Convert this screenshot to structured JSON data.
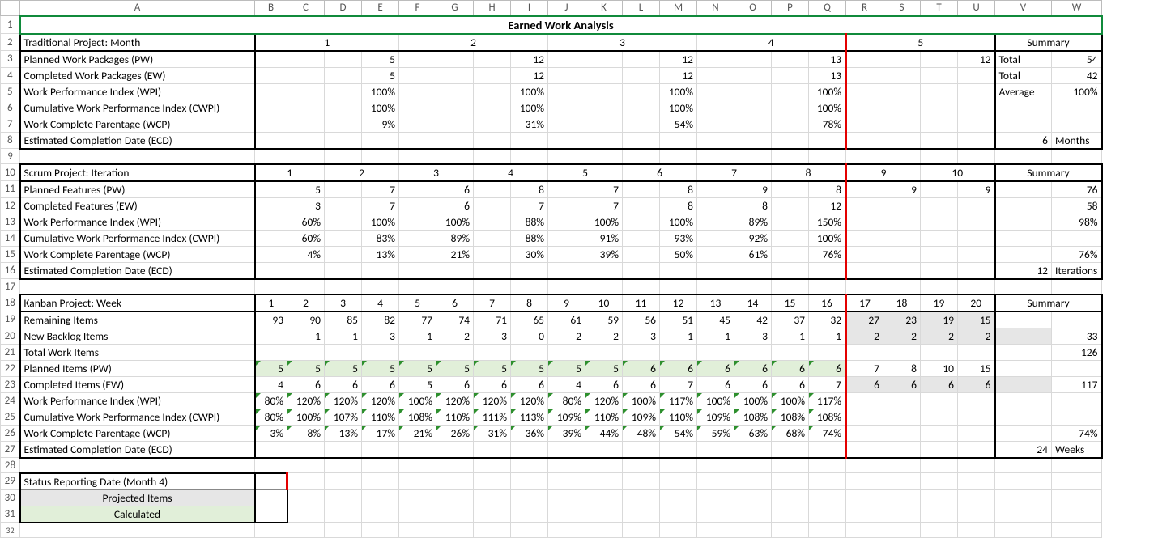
{
  "chart_data": {
    "type": "table",
    "title": "Earned Work Analysis",
    "sections": [
      {
        "name": "Traditional Project: Month",
        "periods": [
          1,
          2,
          3,
          4,
          5
        ],
        "rows": {
          "Planned Work Packages (PW)": [
            5,
            12,
            12,
            13,
            12
          ],
          "Completed Work Packages (EW)": [
            5,
            12,
            12,
            13,
            null
          ],
          "Work Performance Index (WPI)": [
            "100%",
            "100%",
            "100%",
            "100%",
            null
          ],
          "Cumulative Work Performance Index (CWPI)": [
            "100%",
            "100%",
            "100%",
            "100%",
            null
          ],
          "Work Complete Parentage (WCP)": [
            "9%",
            "31%",
            "54%",
            "78%",
            null
          ]
        },
        "summary": {
          "pw_total": 54,
          "ew_total": 42,
          "wpi_avg": "100%",
          "ecd": "6 Months"
        }
      },
      {
        "name": "Scrum Project: Iteration",
        "periods": [
          1,
          2,
          3,
          4,
          5,
          6,
          7,
          8,
          9,
          10
        ],
        "rows": {
          "Planned Features (PW)": [
            5,
            7,
            6,
            8,
            7,
            8,
            9,
            8,
            9,
            9
          ],
          "Completed Features (EW)": [
            3,
            7,
            6,
            7,
            7,
            8,
            8,
            12,
            null,
            null
          ],
          "Work Performance Index (WPI)": [
            "60%",
            "100%",
            "100%",
            "88%",
            "100%",
            "100%",
            "89%",
            "150%",
            null,
            null
          ],
          "Cumulative Work Performance Index (CWPI)": [
            "60%",
            "83%",
            "89%",
            "88%",
            "91%",
            "93%",
            "92%",
            "100%",
            null,
            null
          ],
          "Work Complete Parentage (WCP)": [
            "4%",
            "13%",
            "21%",
            "30%",
            "39%",
            "50%",
            "61%",
            "76%",
            null,
            null
          ]
        },
        "summary": {
          "pw_total": 76,
          "ew_total": 58,
          "wpi_avg": "98%",
          "wcp": "76%",
          "ecd": "12 Iterations"
        }
      },
      {
        "name": "Kanban Project: Week",
        "periods": [
          1,
          2,
          3,
          4,
          5,
          6,
          7,
          8,
          9,
          10,
          11,
          12,
          13,
          14,
          15,
          16,
          17,
          18,
          19,
          20
        ],
        "rows": {
          "Remaining Items": [
            93,
            90,
            85,
            82,
            77,
            74,
            71,
            65,
            61,
            59,
            56,
            51,
            45,
            42,
            37,
            32,
            27,
            23,
            19,
            15
          ],
          "New Backlog Items": [
            null,
            1,
            1,
            3,
            1,
            2,
            3,
            0,
            2,
            2,
            3,
            1,
            1,
            3,
            1,
            1,
            2,
            2,
            2,
            2
          ],
          "Planned Items (PW)": [
            5,
            5,
            5,
            5,
            5,
            5,
            5,
            5,
            5,
            5,
            6,
            6,
            6,
            6,
            6,
            6,
            7,
            8,
            10,
            15
          ],
          "Completed Items (EW)": [
            4,
            6,
            6,
            6,
            5,
            6,
            6,
            6,
            4,
            6,
            6,
            7,
            6,
            6,
            6,
            7,
            6,
            6,
            6,
            6
          ],
          "Work Performance Index (WPI)": [
            "80%",
            "120%",
            "120%",
            "120%",
            "100%",
            "120%",
            "120%",
            "120%",
            "80%",
            "120%",
            "100%",
            "117%",
            "100%",
            "100%",
            "100%",
            "117%",
            null,
            null,
            null,
            null
          ],
          "Cumulative Work Performance Index (CWPI)": [
            "80%",
            "100%",
            "107%",
            "110%",
            "108%",
            "110%",
            "111%",
            "113%",
            "109%",
            "110%",
            "109%",
            "110%",
            "109%",
            "108%",
            "108%",
            "108%",
            null,
            null,
            null,
            null
          ],
          "Work Complete Parentage (WCP)": [
            "3%",
            "8%",
            "13%",
            "17%",
            "21%",
            "26%",
            "31%",
            "36%",
            "39%",
            "44%",
            "48%",
            "54%",
            "59%",
            "63%",
            "68%",
            "74%",
            null,
            null,
            null,
            null
          ]
        },
        "summary": {
          "new_backlog_total": 33,
          "total_work_items": 126,
          "ew_total": 117,
          "wcp": "74%",
          "ecd": "24 Weeks"
        }
      }
    ],
    "status_date": "Status Reporting Date (Month 4)",
    "legend": [
      "Projected Items",
      "Calculated"
    ]
  },
  "col_headers": [
    "",
    "A",
    "B",
    "C",
    "D",
    "E",
    "F",
    "G",
    "H",
    "I",
    "J",
    "K",
    "L",
    "M",
    "N",
    "O",
    "P",
    "Q",
    "R",
    "S",
    "T",
    "U",
    "V",
    "W"
  ],
  "title": "Earned Work Analysis",
  "r2": {
    "a": "Traditional Project: Month",
    "periods": [
      "1",
      "2",
      "3",
      "4",
      "5"
    ],
    "sum": "Summary"
  },
  "r3": {
    "a": "Planned Work Packages (PW)",
    "v": [
      "5",
      "12",
      "12",
      "13",
      "12"
    ],
    "slabel": "Total",
    "sval": "54"
  },
  "r4": {
    "a": "Completed Work Packages (EW)",
    "v": [
      "5",
      "12",
      "12",
      "13"
    ],
    "slabel": "Total",
    "sval": "42"
  },
  "r5": {
    "a": "Work Performance Index (WPI)",
    "v": [
      "100%",
      "100%",
      "100%",
      "100%"
    ],
    "slabel": "Average",
    "sval": "100%"
  },
  "r6": {
    "a": "Cumulative Work Performance Index (CWPI)",
    "v": [
      "100%",
      "100%",
      "100%",
      "100%"
    ]
  },
  "r7": {
    "a": "Work Complete Parentage (WCP)",
    "v": [
      "9%",
      "31%",
      "54%",
      "78%"
    ]
  },
  "r8": {
    "a": "Estimated Completion Date (ECD)",
    "sval_pre": "6",
    "sval_post": "Months"
  },
  "r10": {
    "a": "Scrum Project: Iteration",
    "periods": [
      "1",
      "2",
      "3",
      "4",
      "5",
      "6",
      "7",
      "8",
      "9",
      "10"
    ],
    "sum": "Summary"
  },
  "r11": {
    "a": "Planned Features (PW)",
    "v": [
      "5",
      "7",
      "6",
      "8",
      "7",
      "8",
      "9",
      "8",
      "9",
      "9"
    ],
    "sval": "76"
  },
  "r12": {
    "a": "Completed Features (EW)",
    "v": [
      "3",
      "7",
      "6",
      "7",
      "7",
      "8",
      "8",
      "12"
    ],
    "sval": "58"
  },
  "r13": {
    "a": "Work Performance Index (WPI)",
    "v": [
      "60%",
      "100%",
      "100%",
      "88%",
      "100%",
      "100%",
      "89%",
      "150%"
    ],
    "sval": "98%"
  },
  "r14": {
    "a": "Cumulative Work Performance Index (CWPI)",
    "v": [
      "60%",
      "83%",
      "89%",
      "88%",
      "91%",
      "93%",
      "92%",
      "100%"
    ]
  },
  "r15": {
    "a": "Work Complete Parentage (WCP)",
    "v": [
      "4%",
      "13%",
      "21%",
      "30%",
      "39%",
      "50%",
      "61%",
      "76%"
    ],
    "sval": "76%"
  },
  "r16": {
    "a": "Estimated Completion Date (ECD)",
    "sval_pre": "12",
    "sval_post": "Iterations"
  },
  "r18": {
    "a": "Kanban Project: Week",
    "periods": [
      "1",
      "2",
      "3",
      "4",
      "5",
      "6",
      "7",
      "8",
      "9",
      "10",
      "11",
      "12",
      "13",
      "14",
      "15",
      "16",
      "17",
      "18",
      "19",
      "20"
    ],
    "sum": "Summary"
  },
  "r19": {
    "a": "Remaining Items",
    "v": [
      "93",
      "90",
      "85",
      "82",
      "77",
      "74",
      "71",
      "65",
      "61",
      "59",
      "56",
      "51",
      "45",
      "42",
      "37",
      "32",
      "27",
      "23",
      "19",
      "15"
    ]
  },
  "r20": {
    "a": "New Backlog Items",
    "v": [
      "",
      "1",
      "1",
      "3",
      "1",
      "2",
      "3",
      "0",
      "2",
      "2",
      "3",
      "1",
      "1",
      "3",
      "1",
      "1",
      "2",
      "2",
      "2",
      "2"
    ],
    "sval": "33"
  },
  "r21": {
    "a": "Total Work Items",
    "sval": "126"
  },
  "r22": {
    "a": "Planned Items (PW)",
    "v": [
      "5",
      "5",
      "5",
      "5",
      "5",
      "5",
      "5",
      "5",
      "5",
      "5",
      "6",
      "6",
      "6",
      "6",
      "6",
      "6",
      "7",
      "8",
      "10",
      "15"
    ]
  },
  "r23": {
    "a": "Completed Items (EW)",
    "v": [
      "4",
      "6",
      "6",
      "6",
      "5",
      "6",
      "6",
      "6",
      "4",
      "6",
      "6",
      "7",
      "6",
      "6",
      "6",
      "7",
      "6",
      "6",
      "6",
      "6"
    ],
    "sval": "117"
  },
  "r24": {
    "a": "Work Performance Index (WPI)",
    "v": [
      "80%",
      "120%",
      "120%",
      "120%",
      "100%",
      "120%",
      "120%",
      "120%",
      "80%",
      "120%",
      "100%",
      "117%",
      "100%",
      "100%",
      "100%",
      "117%"
    ]
  },
  "r25": {
    "a": "Cumulative Work Performance Index (CWPI)",
    "v": [
      "80%",
      "100%",
      "107%",
      "110%",
      "108%",
      "110%",
      "111%",
      "113%",
      "109%",
      "110%",
      "109%",
      "110%",
      "109%",
      "108%",
      "108%",
      "108%"
    ]
  },
  "r26": {
    "a": "Work Complete Parentage (WCP)",
    "v": [
      "3%",
      "8%",
      "13%",
      "17%",
      "21%",
      "26%",
      "31%",
      "36%",
      "39%",
      "44%",
      "48%",
      "54%",
      "59%",
      "63%",
      "68%",
      "74%"
    ],
    "sval": "74%"
  },
  "r27": {
    "a": "Estimated Completion Date (ECD)",
    "sval_pre": "24",
    "sval_post": "Weeks"
  },
  "r29": {
    "a": "Status Reporting Date (Month 4)"
  },
  "r30": {
    "a": "Projected Items"
  },
  "r31": {
    "a": "Calculated"
  }
}
